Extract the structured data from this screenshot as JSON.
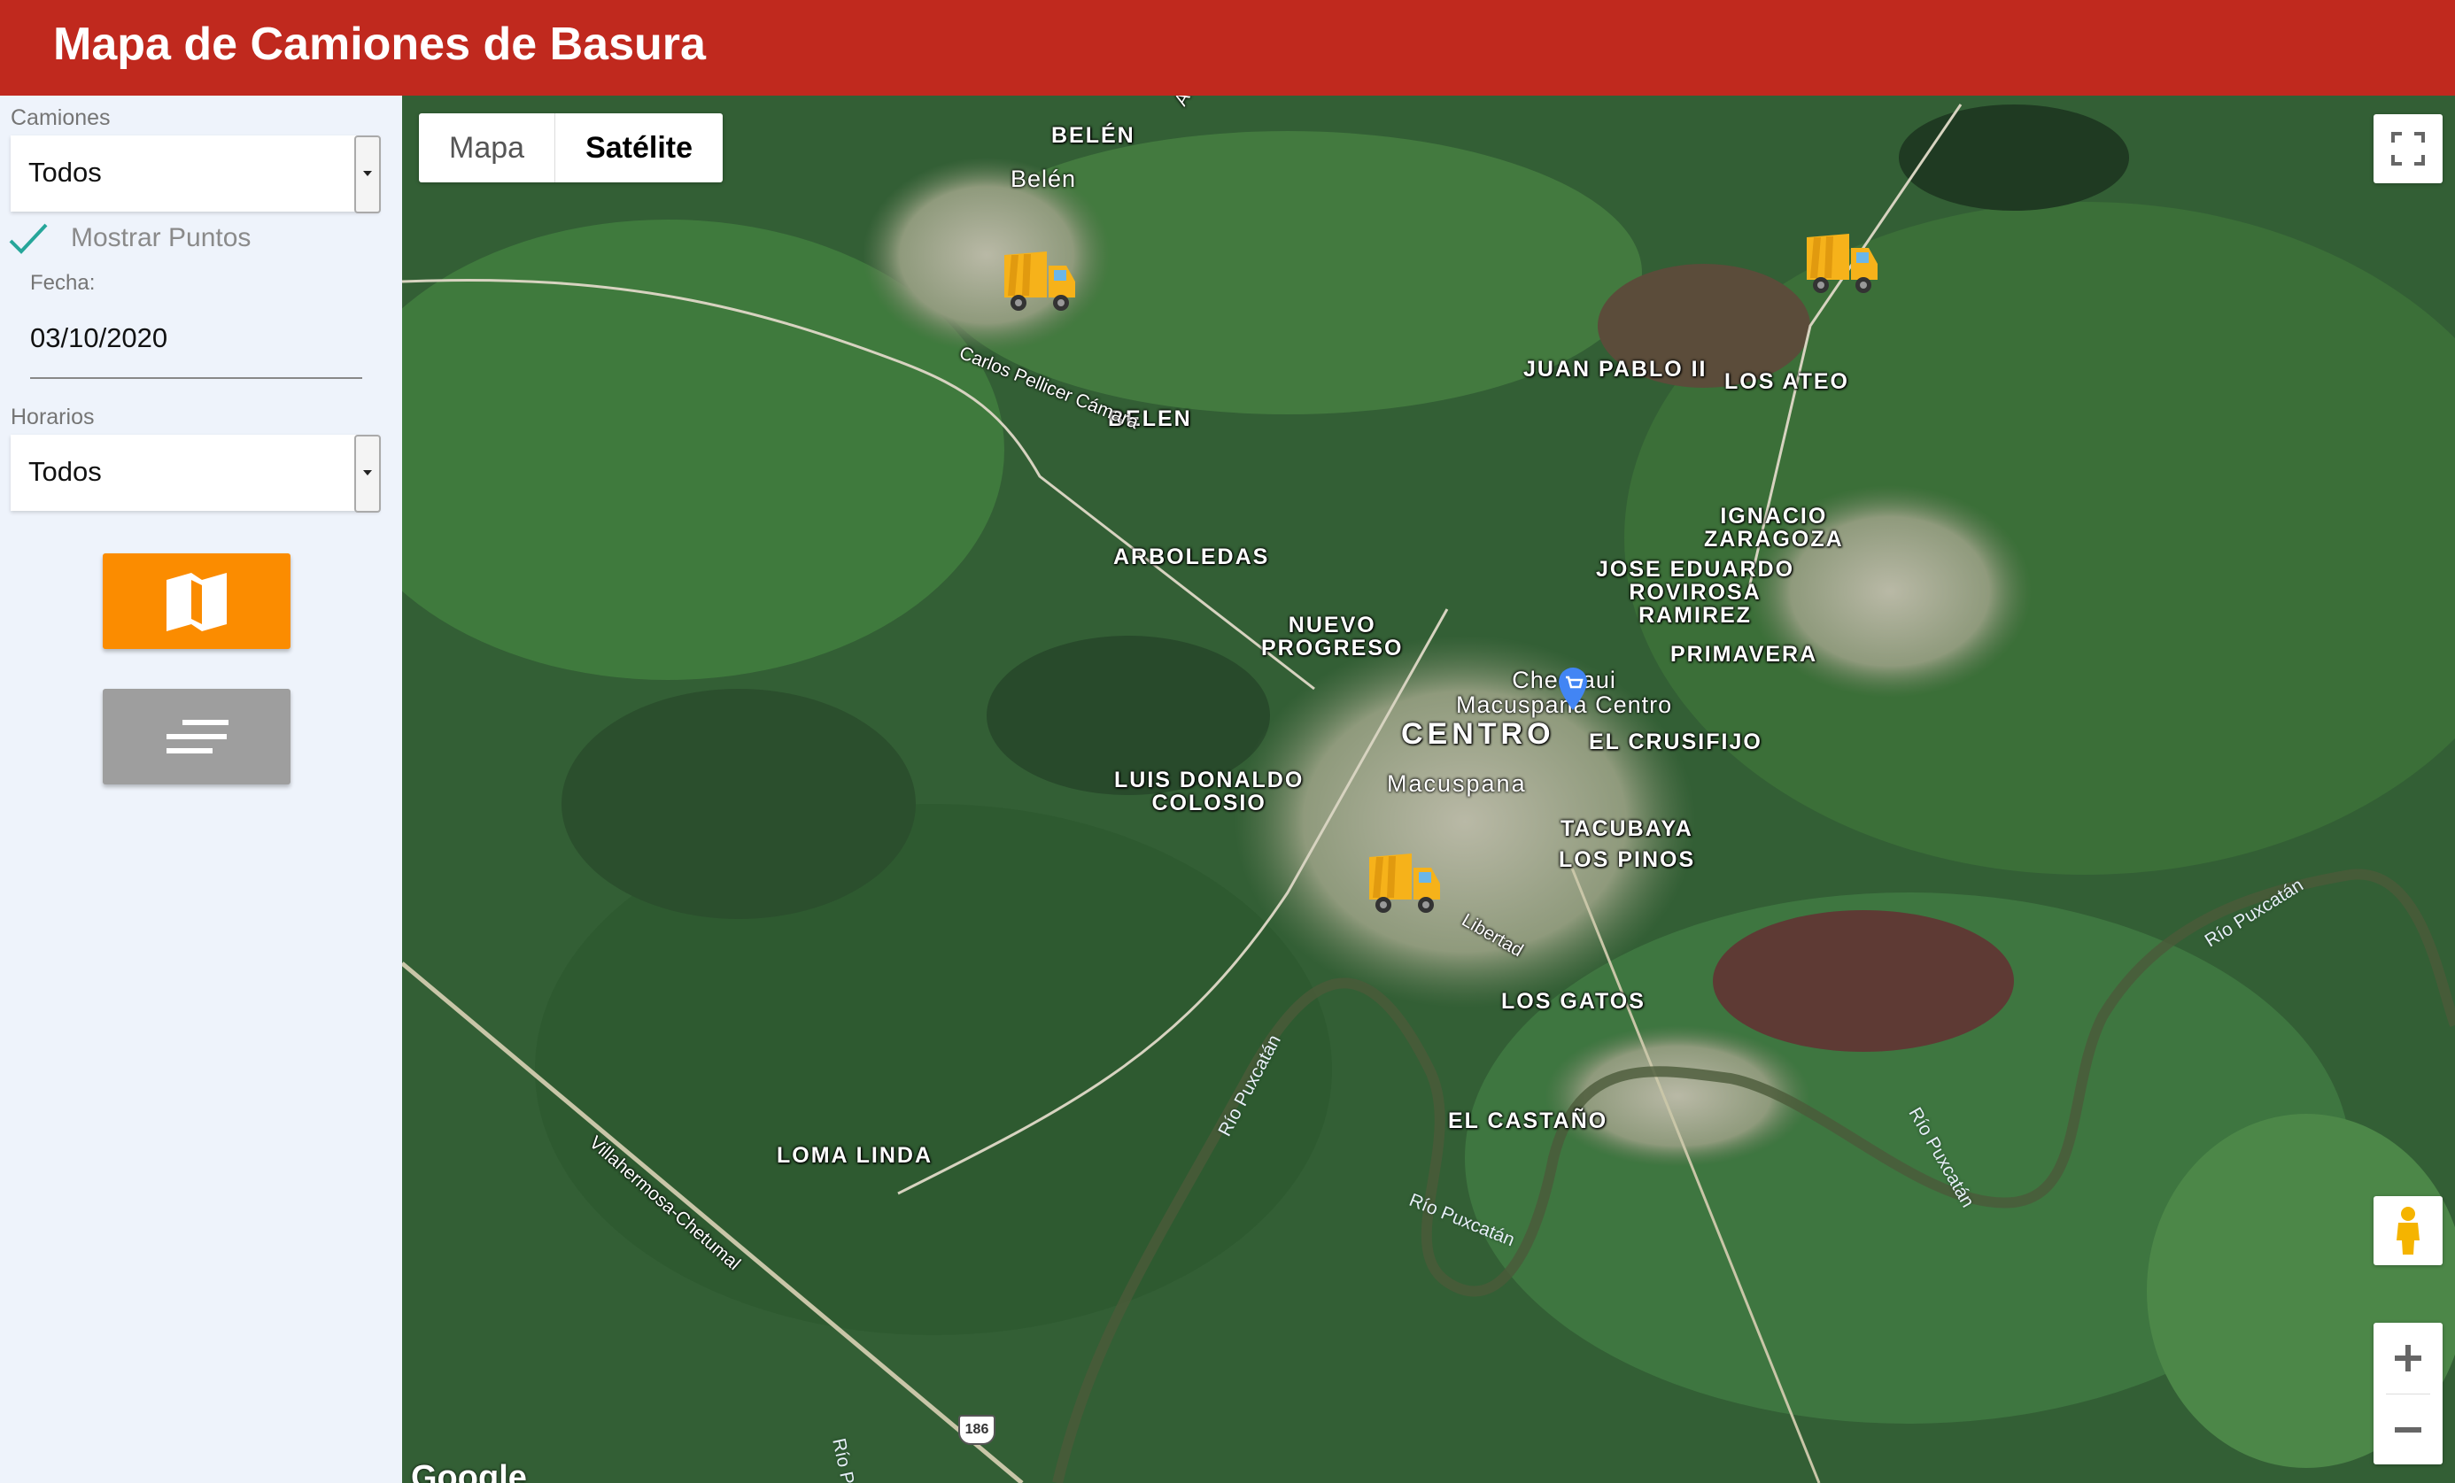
{
  "header": {
    "title": "Mapa de Camiones de Basura"
  },
  "sidebar": {
    "camiones_label": "Camiones",
    "camiones_value": "Todos",
    "mostrar_puntos_label": "Mostrar Puntos",
    "mostrar_puntos_checked": true,
    "fecha_label": "Fecha:",
    "fecha_value": "03/10/2020",
    "horarios_label": "Horarios",
    "horarios_value": "Todos",
    "map_button_icon": "map-icon",
    "list_button_icon": "list-lines-icon"
  },
  "map": {
    "maptype": {
      "mapa": "Mapa",
      "satelite": "Satélite",
      "selected": "Satélite"
    },
    "places": {
      "belen_upper": "BELÉN",
      "belen_small": "Belén",
      "belen": "BELEN",
      "juan_pablo": "JUAN PABLO II",
      "los_ateo": "LOS ATEO",
      "ignacio1": "IGNACIO",
      "ignacio2": "ZARAGOZA",
      "jose1": "JOSE EDUARDO",
      "jose2": "ROVIROSA",
      "jose3": "RAMIREZ",
      "arboledas": "ARBOLEDAS",
      "primavera": "PRIMAVERA",
      "nuevo1": "NUEVO",
      "nuevo2": "PROGRESO",
      "chedraui1": "Chedraui",
      "chedraui2": "Macuspana Centro",
      "centro": "CENTRO",
      "crusifijo": "EL CRUSIFIJO",
      "macuspana": "Macuspana",
      "luis1": "LUIS DONALDO",
      "luis2": "COLOSIO",
      "tacubaya": "TACUBAYA",
      "pinos": "LOS PINOS",
      "gatos": "LOS GATOS",
      "castano": "EL CASTAÑO",
      "loma": "LOMA LINDA"
    },
    "roads": {
      "carlos": "Carlos Pellicer Cámara",
      "villahermosa": "Villahermosa-Chetumal",
      "libertad": "Libertad",
      "highway": "186",
      "top_a": "A"
    },
    "rivers": {
      "r1": "Río Puxcatán",
      "r2": "Río Puxcatán",
      "r3": "Río Puxcatán",
      "r4": "Río Puxcatán",
      "r5": "Río Pu"
    },
    "google_logo": "Google",
    "colors": {
      "header": "#c0291e",
      "map_button": "#fb8c00",
      "list_button": "#9e9e9e",
      "check": "#26a69a"
    }
  }
}
